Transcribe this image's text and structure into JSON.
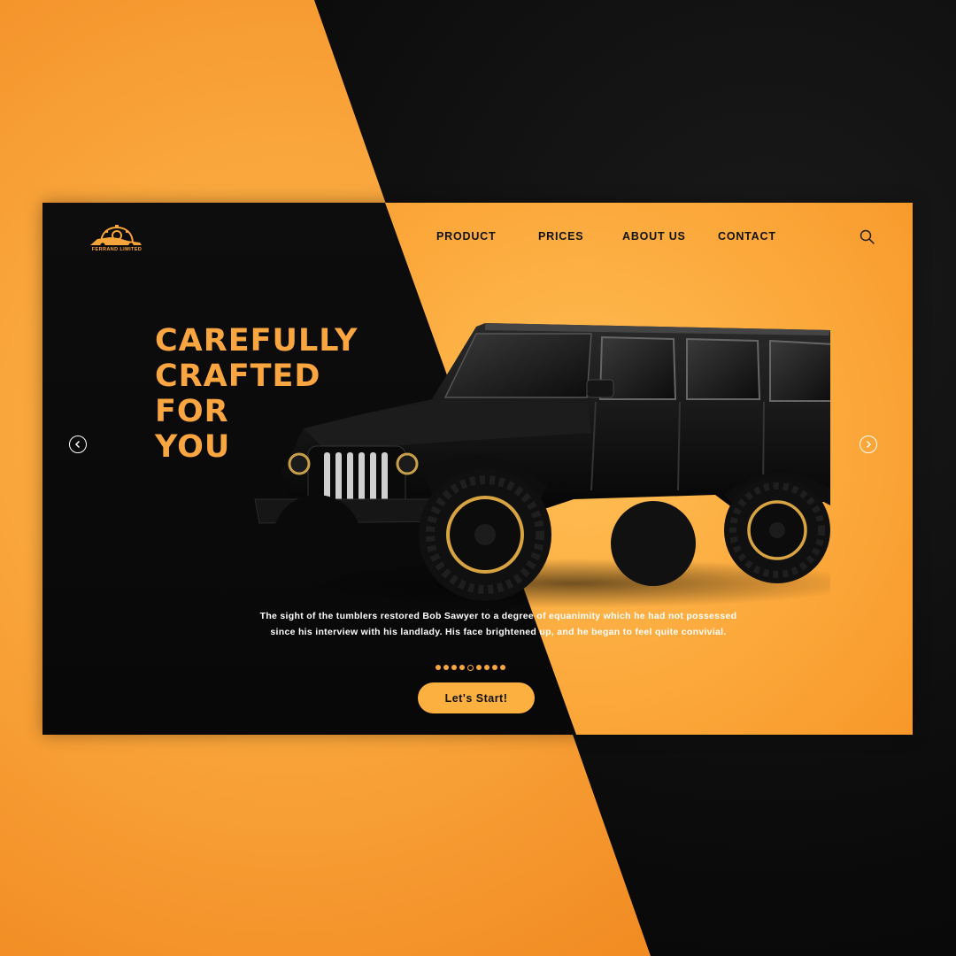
{
  "brand": {
    "name": "FERRAND LIMITED",
    "accent": "#f9a540",
    "dark": "#0a0a0a"
  },
  "nav": {
    "items": [
      {
        "label": "PRODUCT"
      },
      {
        "label": "PRICES"
      },
      {
        "label": "ABOUT US"
      },
      {
        "label": "CONTACT"
      }
    ]
  },
  "icons": {
    "search": "search-icon",
    "prev": "chevron-left-icon",
    "next": "chevron-right-icon",
    "logo": "car-gear-logo-icon"
  },
  "hero": {
    "headline": [
      "CAREFULLY",
      "CRAFTED",
      "FOR",
      "YOU"
    ],
    "description": [
      "The sight of the tumblers restored Bob Sawyer to a degree of equanimity which he had not possessed",
      "since his interview with his landlady. His face brightened up, and he began to feel quite convivial."
    ],
    "cta_label": "Let's Start!",
    "carousel": {
      "total_slides": 9,
      "active_index": 4
    }
  }
}
